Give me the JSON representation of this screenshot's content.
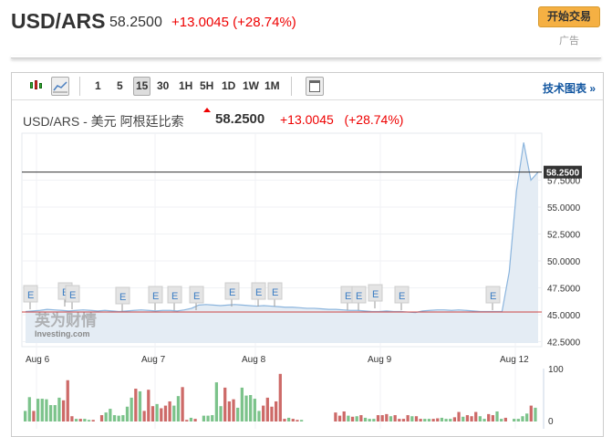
{
  "header": {
    "symbol": "USD/ARS",
    "price": "58.2500",
    "change": "+13.0045 (+28.74%)",
    "trade_button": "开始交易",
    "ad_label": "广告"
  },
  "toolbar": {
    "intervals": [
      "1",
      "5",
      "15",
      "30",
      "1H",
      "5H",
      "1D",
      "1W",
      "1M"
    ],
    "selected_interval": "15",
    "tech_chart_link": "技术图表 »",
    "icons": [
      "candlestick-icon",
      "line-chart-icon",
      "layout-icon"
    ]
  },
  "chart": {
    "title": "USD/ARS - 美元 阿根廷比索",
    "price": "58.2500",
    "change": "+13.0045",
    "change_pct": "(+28.74%)",
    "watermark": "英为财情 Investing.com"
  },
  "colors": {
    "up": "#e00",
    "volume_up": "#7cc38b",
    "volume_down": "#cd6a68",
    "line": "#8ab4dd",
    "fill": "#e4ecf4"
  },
  "chart_data": {
    "type": "line",
    "x_tick_labels": [
      "Aug 6",
      "Aug 7",
      "Aug 8",
      "Aug 9",
      "Aug 12"
    ],
    "y_tick_labels": [
      "42.5000",
      "45.0000",
      "47.5000",
      "50.0000",
      "52.5000",
      "55.0000",
      "57.5000"
    ],
    "ylim": [
      42.5,
      61
    ],
    "last_price_label": "58.2500",
    "last_price": 58.25,
    "reference_line": 45.25,
    "price": [
      45.3,
      45.35,
      45.4,
      45.5,
      45.45,
      45.4,
      45.35,
      45.4,
      45.45,
      45.4,
      45.35,
      45.4,
      45.35,
      45.3,
      45.35,
      45.4,
      45.45,
      45.4,
      45.35,
      45.4,
      45.4,
      45.35,
      45.45,
      45.6,
      45.9,
      45.95,
      45.9,
      45.85,
      45.9,
      45.95,
      45.9,
      45.85,
      45.8,
      45.85,
      45.8,
      45.75,
      45.7,
      45.7,
      45.65,
      45.6,
      45.6,
      45.55,
      45.5,
      45.5,
      45.45,
      45.4,
      45.4,
      45.35,
      45.3,
      45.3,
      45.35,
      45.3,
      45.3,
      45.25,
      45.2,
      45.35,
      45.4,
      45.45,
      45.45,
      45.4,
      45.45,
      45.4,
      45.35,
      45.3,
      45.3,
      45.3,
      45.3,
      49,
      56.5,
      61,
      57.5,
      58.25
    ],
    "e_markers": 13,
    "volume_ylim": [
      0,
      100
    ],
    "volume_tick_labels": [
      "100",
      "0"
    ],
    "volume": [
      [
        20,
        "u"
      ],
      [
        46,
        "u"
      ],
      [
        20,
        "d"
      ],
      [
        43,
        "u"
      ],
      [
        43,
        "u"
      ],
      [
        42,
        "u"
      ],
      [
        31,
        "u"
      ],
      [
        31,
        "u"
      ],
      [
        45,
        "u"
      ],
      [
        40,
        "d"
      ],
      [
        78,
        "d"
      ],
      [
        10,
        "d"
      ],
      [
        5,
        "u"
      ],
      [
        5,
        "d"
      ],
      [
        5,
        "u"
      ],
      [
        3,
        "u"
      ],
      [
        3,
        "d"
      ],
      null,
      [
        12,
        "d"
      ],
      [
        17,
        "u"
      ],
      [
        24,
        "u"
      ],
      [
        12,
        "u"
      ],
      [
        11,
        "u"
      ],
      [
        12,
        "u"
      ],
      [
        28,
        "u"
      ],
      [
        45,
        "u"
      ],
      [
        62,
        "d"
      ],
      [
        57,
        "u"
      ],
      [
        20,
        "d"
      ],
      [
        60,
        "d"
      ],
      [
        29,
        "d"
      ],
      [
        33,
        "u"
      ],
      [
        25,
        "d"
      ],
      [
        30,
        "d"
      ],
      [
        38,
        "d"
      ],
      [
        30,
        "u"
      ],
      [
        48,
        "u"
      ],
      [
        65,
        "d"
      ],
      [
        3,
        "d"
      ],
      [
        7,
        "u"
      ],
      [
        5,
        "d"
      ],
      null,
      [
        11,
        "u"
      ],
      [
        11,
        "u"
      ],
      [
        12,
        "u"
      ],
      [
        74,
        "u"
      ],
      [
        29,
        "u"
      ],
      [
        64,
        "d"
      ],
      [
        38,
        "d"
      ],
      [
        42,
        "d"
      ],
      [
        26,
        "u"
      ],
      [
        64,
        "u"
      ],
      [
        49,
        "u"
      ],
      [
        50,
        "u"
      ],
      [
        43,
        "u"
      ],
      [
        20,
        "u"
      ],
      [
        30,
        "d"
      ],
      [
        45,
        "d"
      ],
      [
        28,
        "d"
      ],
      [
        38,
        "d"
      ],
      [
        90,
        "d"
      ],
      [
        5,
        "d"
      ],
      [
        7,
        "u"
      ],
      [
        5,
        "d"
      ],
      [
        3,
        "d"
      ],
      [
        3,
        "u"
      ],
      null,
      null,
      null,
      null,
      null,
      null,
      null,
      [
        17,
        "d"
      ],
      [
        11,
        "d"
      ],
      [
        19,
        "d"
      ],
      [
        11,
        "u"
      ],
      [
        9,
        "d"
      ],
      [
        10,
        "u"
      ],
      [
        12,
        "d"
      ],
      [
        7,
        "u"
      ],
      [
        5,
        "u"
      ],
      [
        5,
        "u"
      ],
      [
        12,
        "d"
      ],
      [
        12,
        "d"
      ],
      [
        14,
        "d"
      ],
      [
        10,
        "u"
      ],
      [
        12,
        "d"
      ],
      [
        5,
        "d"
      ],
      [
        5,
        "d"
      ],
      [
        12,
        "d"
      ],
      [
        10,
        "u"
      ],
      [
        10,
        "d"
      ],
      [
        5,
        "d"
      ],
      [
        5,
        "u"
      ],
      [
        5,
        "u"
      ],
      [
        5,
        "d"
      ],
      [
        6,
        "d"
      ],
      [
        7,
        "u"
      ],
      [
        5,
        "u"
      ],
      [
        5,
        "u"
      ],
      [
        8,
        "d"
      ],
      [
        18,
        "d"
      ],
      [
        9,
        "u"
      ],
      [
        12,
        "d"
      ],
      [
        10,
        "d"
      ],
      [
        18,
        "d"
      ],
      [
        10,
        "u"
      ],
      [
        5,
        "u"
      ],
      [
        14,
        "d"
      ],
      [
        12,
        "d"
      ],
      [
        19,
        "u"
      ],
      [
        5,
        "u"
      ],
      [
        7,
        "d"
      ],
      null,
      [
        5,
        "u"
      ],
      [
        5,
        "u"
      ],
      [
        10,
        "u"
      ],
      [
        15,
        "u"
      ],
      [
        30,
        "d"
      ],
      [
        26,
        "u"
      ]
    ]
  }
}
